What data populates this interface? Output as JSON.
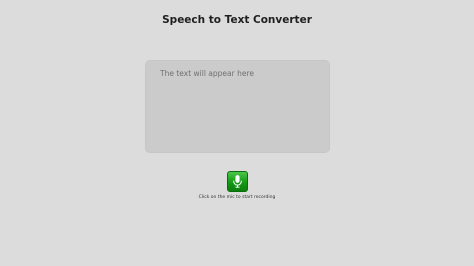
{
  "header": {
    "title": "Speech to Text Converter"
  },
  "transcript": {
    "placeholder": "The text will appear here"
  },
  "mic": {
    "icon": "microphone-icon",
    "hint": "Click on the mic to start recording",
    "color": "#139a13"
  }
}
